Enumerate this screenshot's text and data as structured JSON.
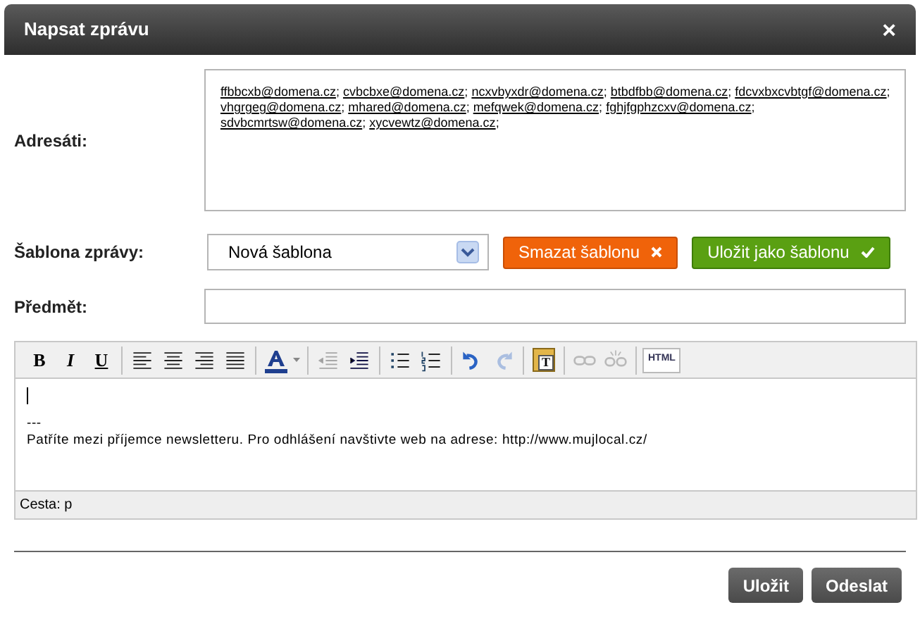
{
  "window": {
    "title": "Napsat zprávu",
    "close": "×"
  },
  "recipients": {
    "label": "Adresáti:",
    "separator": ";",
    "emails": [
      "ffbbcxb@domena.cz",
      "cvbcbxe@domena.cz",
      "ncxvbyxdr@domena.cz",
      "btbdfbb@domena.cz",
      "fdcvxbxcvbtgf@domena.cz",
      "vhgrgeg@domena.cz",
      "mhared@domena.cz",
      "mefqwek@domena.cz",
      "fghjfgphzcxv@domena.cz",
      "sdvbcmrtsw@domena.cz",
      "xycvewtz@domena.cz"
    ]
  },
  "template": {
    "label": "Šablona zprávy:",
    "value": "Nová šablona",
    "delete_button": "Smazat šablonu",
    "save_button": "Uložit jako šablonu"
  },
  "subject": {
    "label": "Předmět:"
  },
  "editor": {
    "toolbar": [
      {
        "kind": "bold",
        "label": "B",
        "disabled": false
      },
      {
        "kind": "italic",
        "label": "I",
        "disabled": false
      },
      {
        "kind": "underline",
        "label": "U",
        "disabled": false
      },
      {
        "kind": "sep"
      },
      {
        "kind": "align-left",
        "disabled": false
      },
      {
        "kind": "align-center",
        "disabled": false
      },
      {
        "kind": "align-right",
        "disabled": false
      },
      {
        "kind": "justify",
        "disabled": false
      },
      {
        "kind": "sep"
      },
      {
        "kind": "text-color",
        "disabled": false
      },
      {
        "kind": "sep"
      },
      {
        "kind": "outdent",
        "disabled": true
      },
      {
        "kind": "indent",
        "disabled": false
      },
      {
        "kind": "sep"
      },
      {
        "kind": "bullets",
        "disabled": false
      },
      {
        "kind": "numbers",
        "disabled": false
      },
      {
        "kind": "sep"
      },
      {
        "kind": "undo",
        "disabled": false
      },
      {
        "kind": "redo",
        "disabled": true
      },
      {
        "kind": "sep"
      },
      {
        "kind": "paste-text",
        "label": "T",
        "disabled": false
      },
      {
        "kind": "sep"
      },
      {
        "kind": "link",
        "disabled": true
      },
      {
        "kind": "unlink",
        "disabled": true
      },
      {
        "kind": "sep"
      },
      {
        "kind": "html",
        "label": "HTML",
        "disabled": false
      }
    ],
    "lines": [
      "---",
      "Patříte mezi příjemce newsletteru. Pro odhlášení navštivte web na adrese: http://www.mujlocal.cz/"
    ],
    "path": "Cesta: p"
  },
  "buttons": [
    {
      "label": "Uložit"
    },
    {
      "label": "Odeslat"
    }
  ]
}
